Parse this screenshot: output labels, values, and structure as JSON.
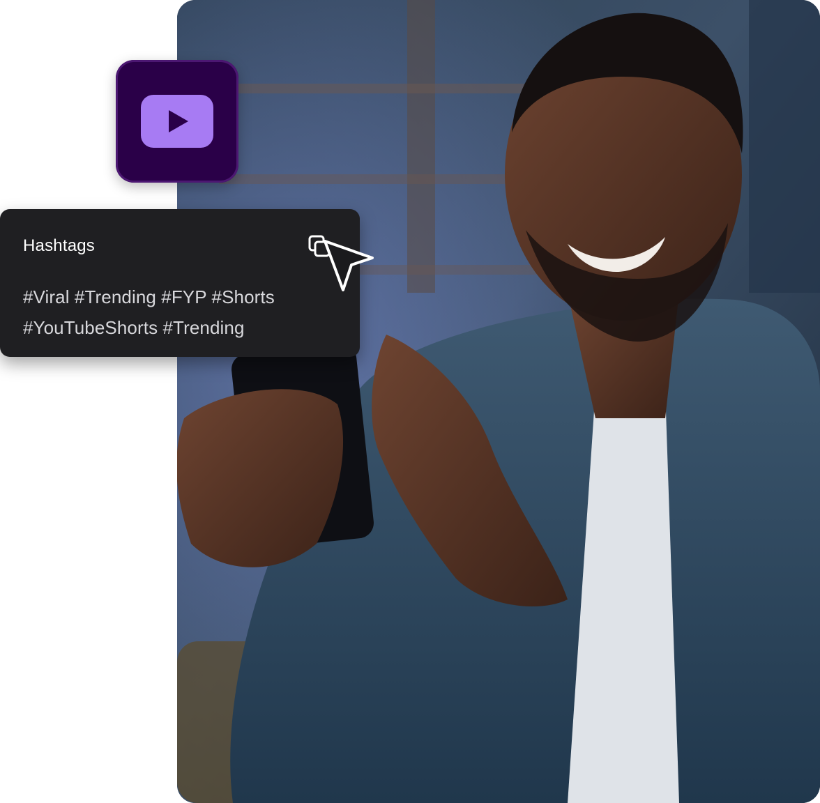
{
  "hashtag_card": {
    "title": "Hashtags",
    "tags_line_1": "#Viral #Trending #FYP #Shorts",
    "tags_line_2": "#YouTubeShorts #Trending"
  },
  "icons": {
    "app_tile": "youtube-play-icon",
    "copy": "copy-icon",
    "cursor": "cursor-pointer-icon"
  },
  "colors": {
    "tile_background": "#2a0048",
    "tile_accent": "#a77bf3",
    "card_background": "#1f1f22",
    "card_text": "#ffffff"
  }
}
